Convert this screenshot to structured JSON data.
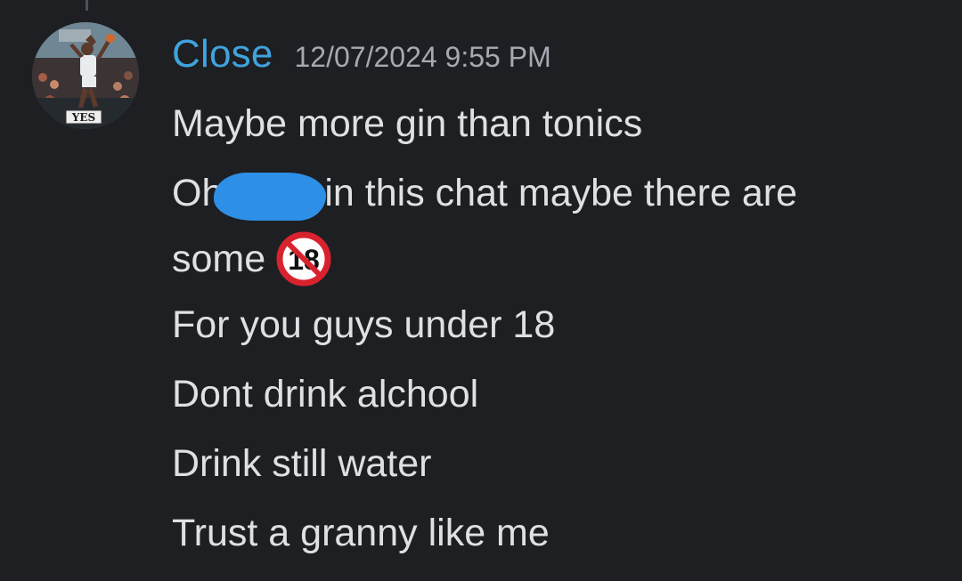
{
  "message": {
    "author": "Close",
    "author_color": "#3fa3dd",
    "timestamp": "12/07/2024 9:55 PM",
    "avatar": {
      "icon": "basketball-player-avatar",
      "badge_text": "YES"
    },
    "lines": [
      "Maybe more gin than tonics",
      {
        "before": "Oh",
        "after": "in this chat maybe there are"
      },
      {
        "text": "some",
        "emoji": "no-one-under-eighteen-icon",
        "emoji_label": "18"
      },
      "For you guys under 18",
      "Dont drink alchool",
      "Drink still water",
      "Trust a granny like me"
    ]
  },
  "colors": {
    "background": "#1e1f22",
    "text": "#dfe0e4",
    "timestamp": "#a7a9b2",
    "redaction": "#2e8fe6",
    "emoji_ring": "#d8232f"
  }
}
